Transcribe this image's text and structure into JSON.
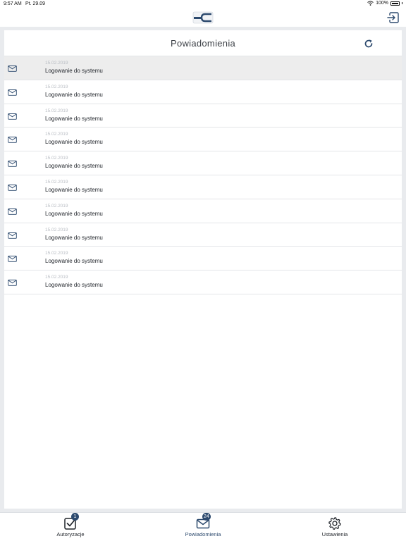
{
  "status_bar": {
    "time": "9:57 AM",
    "date": "Pt. 29.09",
    "battery": "100%"
  },
  "header": {
    "logo_icon": "bank-logo-icon",
    "logout_icon": "logout-icon"
  },
  "notifications": {
    "title": "Powiadomienia",
    "refresh_icon": "refresh-icon",
    "items": [
      {
        "date": "15.02.2019",
        "text": "Logowanie do systemu",
        "selected": true
      },
      {
        "date": "15.02.2019",
        "text": "Logowanie do systemu"
      },
      {
        "date": "15.02.2019",
        "text": "Logowanie do systemu"
      },
      {
        "date": "15.02.2019",
        "text": "Logowanie do systemu"
      },
      {
        "date": "15.02.2019",
        "text": "Logowanie do systemu"
      },
      {
        "date": "15.02.2019",
        "text": "Logowanie do systemu"
      },
      {
        "date": "15.02.2019",
        "text": "Logowanie do systemu"
      },
      {
        "date": "15.02.2019",
        "text": "Logowanie do systemu"
      },
      {
        "date": "15.02.2019",
        "text": "Logowanie do systemu"
      },
      {
        "date": "15.02.2019",
        "text": "Logowanie do systemu"
      }
    ]
  },
  "tabs": [
    {
      "label": "Autoryzacje",
      "icon": "checkbox-icon",
      "badge": "1"
    },
    {
      "label": "Powiadomienia",
      "icon": "mail-icon",
      "badge": "24",
      "active": true
    },
    {
      "label": "Ustawienia",
      "icon": "gear-icon"
    }
  ],
  "colors": {
    "accent": "#2d4a6e",
    "background": "#e9ebee",
    "divider": "#e3e5e8",
    "date_text": "#b9bdc3"
  }
}
